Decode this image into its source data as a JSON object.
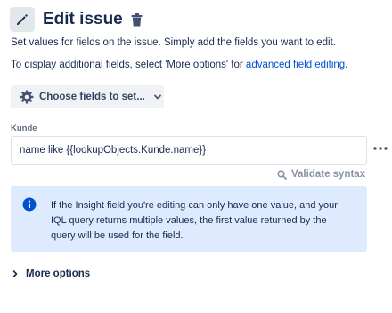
{
  "header": {
    "title": "Edit issue",
    "badge_icon": "pencil-icon",
    "delete_icon": "trash-icon"
  },
  "description": {
    "line1": "Set values for fields on the issue. Simply add the fields you want to edit.",
    "line2_prefix": "To display additional fields, select 'More options' for ",
    "line2_link": "advanced field editing",
    "line2_suffix": "."
  },
  "choose_fields": {
    "label": "Choose fields to set...",
    "icon": "gear-icon"
  },
  "field": {
    "label": "Kunde",
    "value": "name like {{lookupObjects.Kunde.name}}",
    "more_icon": "more-horizontal-icon"
  },
  "validate": {
    "label": "Validate syntax",
    "icon": "search-icon"
  },
  "info_panel": {
    "lines": [
      "If the Insight field you're editing can only have one value, and your",
      "IQL query returns multiple values, the first value returned by the",
      "query will be used for the field."
    ],
    "icon": "info-icon"
  },
  "more_options": {
    "label": "More options",
    "icon": "chevron-right-icon"
  },
  "colors": {
    "text": "#172b4d",
    "link": "#0052cc",
    "info_bg": "#deebff",
    "info_icon": "#0052cc",
    "button_bg": "#f1f2f5",
    "muted": "#8993a4"
  }
}
